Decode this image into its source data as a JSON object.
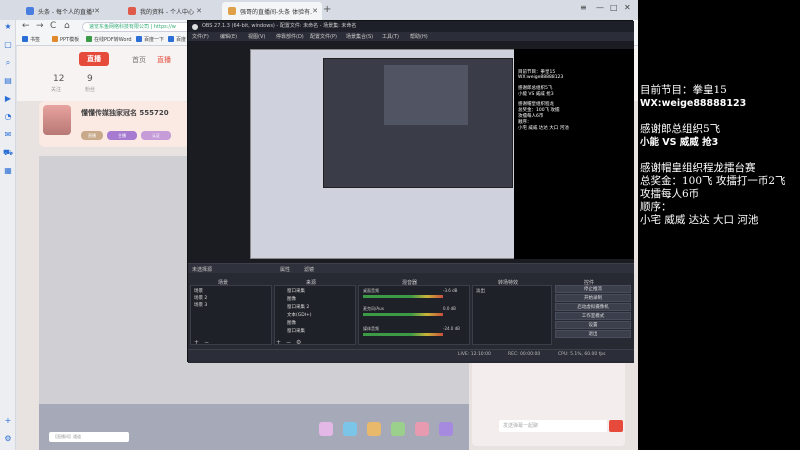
{
  "browser": {
    "tabs": [
      {
        "label": "头条 - 每个人的直播平台",
        "color": "#4a7de0"
      },
      {
        "label": "我的资料 - 个人中心 - 头条",
        "color": "#e05a4a"
      },
      {
        "label": "强哥的直播间-头条 体验有..",
        "color": "#e0a04a"
      }
    ],
    "address": "速览东鱼网络科技有限公司 | https://w",
    "bookmarks": [
      "书签",
      "PPT模板",
      "在线PDF转Word",
      "百度一下",
      "百度"
    ],
    "nav": {
      "back": "←",
      "forward": "→",
      "refresh": "C",
      "home": "⌂"
    },
    "window_controls": {
      "menu": "≡",
      "minimize": "—",
      "maximize": "□",
      "close": "✕"
    }
  },
  "page": {
    "logo": "直播",
    "nav": [
      "首页",
      "直播"
    ],
    "stats": [
      {
        "value": "12",
        "label": "关注"
      },
      {
        "value": "9",
        "label": "粉丝"
      }
    ],
    "anchor_title": "懂懂传媒独家冠名 555720",
    "anchor_chips": [
      "直播",
      "主播",
      "认证"
    ],
    "bottom_input_placeholder": "【直播间】通道",
    "chat_placeholder": "发送弹幕一起聊"
  },
  "obs": {
    "title": "OBS 27.1.3 (64-bit, windows) - 配置文件: 未命名 - 场景集: 未命名",
    "menus": [
      "文件(F)",
      "编辑(E)",
      "视图(V)",
      "停靠部件(D)",
      "配置文件(P)",
      "场景集合(S)",
      "工具(T)",
      "帮助(H)"
    ],
    "nested_texts": [
      "目前节目：拳皇15",
      "WX:weige88888123",
      "感谢郎总组织5飞",
      "小能 VS 威威 抢3",
      "感谢帽皇组织程龙",
      "总奖金：100飞 攻擂",
      "攻擂每人6币",
      "顺序：",
      "小宅 威威 达达 大口 河池"
    ],
    "source_toolbar": [
      "未选择源",
      "属性",
      "滤镜"
    ],
    "panels": {
      "scenes_title": "场景",
      "scenes": [
        "场景",
        "场景 2",
        "场景 3"
      ],
      "sources_title": "来源",
      "sources": [
        "窗口采集",
        "图像",
        "窗口采集 2",
        "文本(GDI+)",
        "图像",
        "窗口采集"
      ],
      "mixer_title": "混音器",
      "mixer": [
        {
          "label": "桌面音频",
          "db": "-3.6 dB"
        },
        {
          "label": "麦克风/Aux",
          "db": "0.0 dB"
        },
        {
          "label": "媒体音频",
          "db": "-24.0 dB"
        }
      ],
      "transitions_title": "转场特效",
      "transition": "淡出",
      "controls_title": "控件",
      "controls": [
        "停止推流",
        "开始录制",
        "启动虚拟摄像机",
        "工作室模式",
        "设置",
        "退出"
      ]
    },
    "status": [
      "LIVE: 12:10:00",
      "REC: 00:00:00",
      "CPU: 5.1%, 60.00 fps"
    ]
  },
  "overlay": {
    "lines": [
      {
        "text": "目前节目：拳皇15",
        "style": "normal"
      },
      {
        "text": "WX:weige88888123",
        "style": "bold"
      },
      {
        "text": "",
        "style": "gap"
      },
      {
        "text": "感谢郎总组织5飞",
        "style": "normal"
      },
      {
        "text": "小能 VS 威威 抢3",
        "style": "mixed"
      },
      {
        "text": "",
        "style": "gap"
      },
      {
        "text": "感谢帽皇组织程龙擂台赛",
        "style": "normal"
      },
      {
        "text": "总奖金：100飞 攻擂打一币2飞",
        "style": "normal"
      },
      {
        "text": "攻擂每人6币",
        "style": "normal"
      },
      {
        "text": "顺序：",
        "style": "normal"
      },
      {
        "text": "小宅 威威 达达 大口 河池",
        "style": "normal"
      }
    ]
  },
  "colors": {
    "accent": "#e64a3b",
    "obs_bg": "#2b2e38",
    "overlay_bg": "#000000"
  }
}
